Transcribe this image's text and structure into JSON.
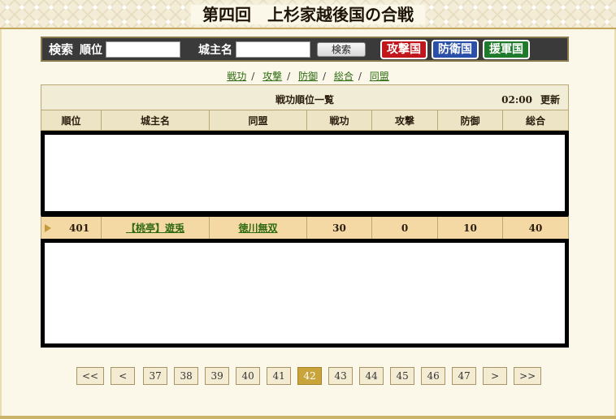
{
  "header": {
    "title": "第四回　上杉家越後国の合戦"
  },
  "search": {
    "label": "検索",
    "rank_label": "順位",
    "rank_value": "",
    "lord_label": "城主名",
    "lord_value": "",
    "submit_label": "検索",
    "btn_attack": "攻撃国",
    "btn_defense": "防衛国",
    "btn_reinforce": "援軍国"
  },
  "tabs": [
    {
      "label": "戦功"
    },
    {
      "label": "攻撃"
    },
    {
      "label": "防御"
    },
    {
      "label": "総合"
    },
    {
      "label": "同盟"
    }
  ],
  "table": {
    "title": "戦功順位一覧",
    "update_time": "02:00",
    "update_label": "更新",
    "columns": [
      "順位",
      "城主名",
      "同盟",
      "戦功",
      "攻撃",
      "防御",
      "総合"
    ],
    "row": {
      "rank": "401",
      "lord": "【桃亭】遊兎",
      "alliance": "徳川無双",
      "merit": "30",
      "attack": "0",
      "defense": "10",
      "total": "40"
    }
  },
  "pagination": {
    "first": "<<",
    "prev": "<",
    "pages": [
      "37",
      "38",
      "39",
      "40",
      "41",
      "42",
      "43",
      "44",
      "45",
      "46",
      "47"
    ],
    "current": "42",
    "next": ">",
    "last": ">>"
  },
  "colors": {
    "attack": "#c0161c",
    "defense": "#2a4fa8",
    "reinforce": "#1f7a2c",
    "highlight_row": "#f5d9a4",
    "current_page": "#c9a43a"
  }
}
